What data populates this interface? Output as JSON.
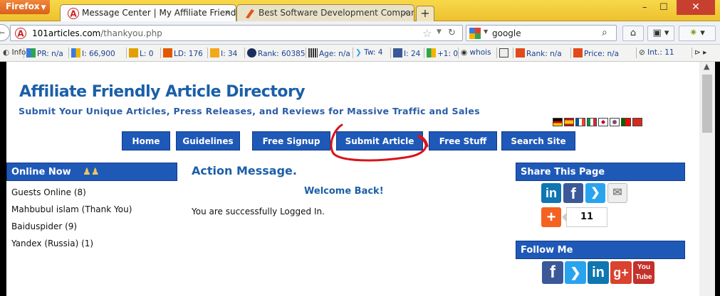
{
  "browser": {
    "menu_label": "Firefox",
    "tabs": [
      {
        "title": "Message Center | My Affiliate Friendl...",
        "active": true
      },
      {
        "title": "Best Software Development Compan...",
        "active": false
      }
    ],
    "new_tab": "+",
    "close_glyph": "×",
    "window_controls": {
      "minimize": "–",
      "maximize": "☐",
      "close": "✕"
    }
  },
  "navbar": {
    "back": "←",
    "url_domain": "101articles.com",
    "url_path": "/thankyou.php",
    "search_text": "google"
  },
  "seo_toolbar": [
    {
      "label": "Info",
      "icon": "info-icon"
    },
    {
      "label": "PR: n/a",
      "icon": "google-icon"
    },
    {
      "label": "I: 66,900",
      "icon": "google-icon"
    },
    {
      "label": "L: 0",
      "icon": "yahoo-icon"
    },
    {
      "label": "LD: 176",
      "icon": "yahoo-icon"
    },
    {
      "label": "I: 34",
      "icon": "bing-icon"
    },
    {
      "label": "Rank: 60385",
      "icon": "alexa-icon"
    },
    {
      "label": "Age: n/a",
      "icon": "archive-icon"
    },
    {
      "label": "Tw: 4",
      "icon": "twitter-icon"
    },
    {
      "label": "I: 24",
      "icon": "facebook-icon"
    },
    {
      "label": "+1: 0",
      "icon": "google-icon"
    },
    {
      "label": "whois",
      "icon": "whois-icon"
    },
    {
      "label": "",
      "icon": "source-icon"
    },
    {
      "label": "Rank: n/a",
      "icon": "semrush-icon"
    },
    {
      "label": "Price: n/a",
      "icon": "semrush-icon"
    },
    {
      "label": "Int.: 11",
      "icon": "links-icon"
    }
  ],
  "site": {
    "title": "Affiliate Friendly Article Directory",
    "tagline": "Submit Your Unique Articles, Press Releases, and Reviews for Massive Traffic and Sales",
    "menu": [
      "Home",
      "Guidelines",
      "Free Signup",
      "Submit Article",
      "Free Stuff",
      "Search Site"
    ],
    "online_now": {
      "heading": "Online Now",
      "items": [
        "Guests Online (8)",
        "Mahbubul islam (Thank You)",
        "Baiduspider (9)",
        "Yandex (Russia) (1)"
      ]
    },
    "main": {
      "heading": "Action Message.",
      "welcome": "Welcome Back!",
      "message": "You are successfully Logged In."
    },
    "share": {
      "heading": "Share This Page",
      "count": "11"
    },
    "follow": {
      "heading": "Follow Me",
      "youtube_top": "You",
      "youtube_bottom": "Tube"
    }
  },
  "colors": {
    "nav_blue": "#1f59b8",
    "title_blue": "#1b5fa8",
    "annotation_red": "#d8141b",
    "firefox_orange": "#e0702b"
  }
}
